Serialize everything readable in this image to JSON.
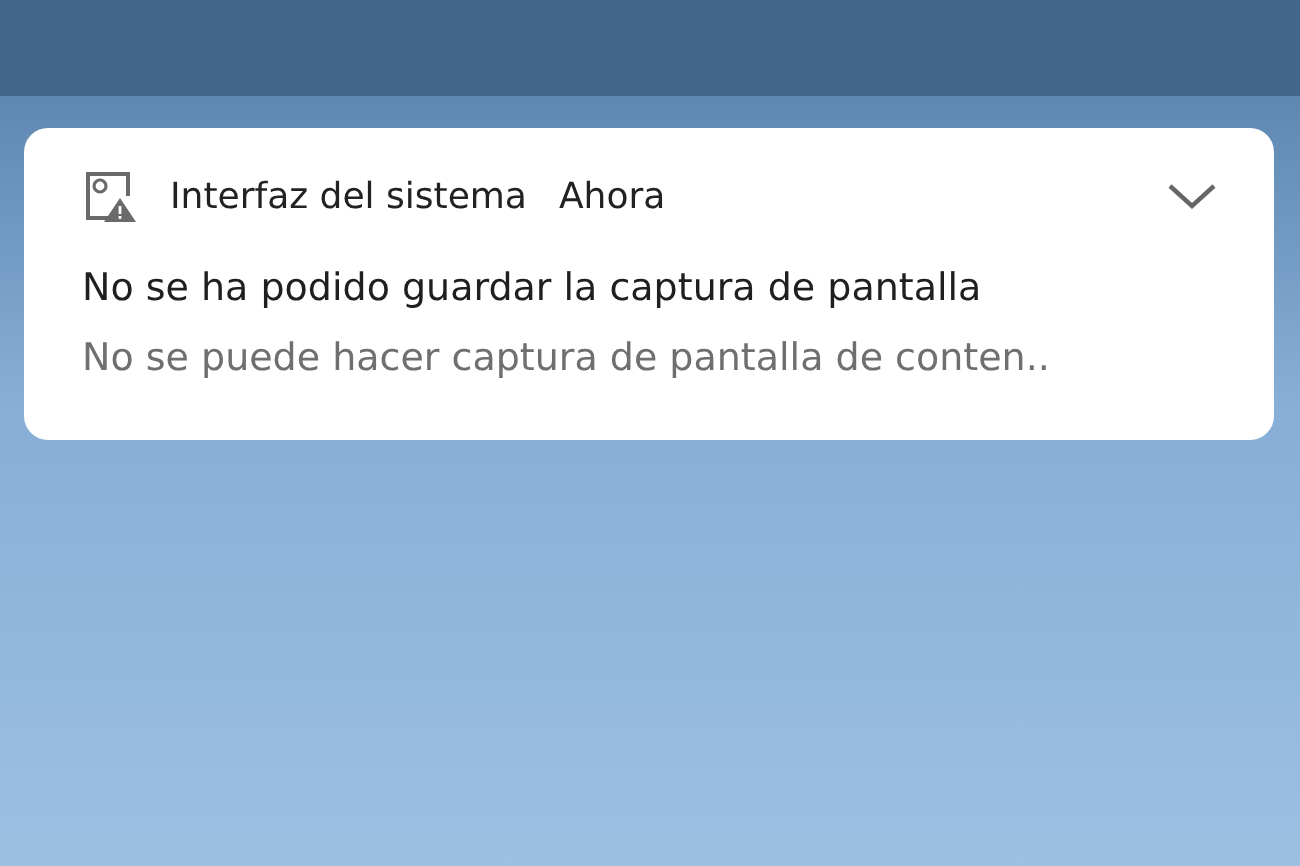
{
  "notification": {
    "app_name": "Interfaz del sistema",
    "time": "Ahora",
    "title": "No se ha podido guardar la captura de pantalla",
    "text": "No se puede hacer captura de pantalla de conten.."
  }
}
